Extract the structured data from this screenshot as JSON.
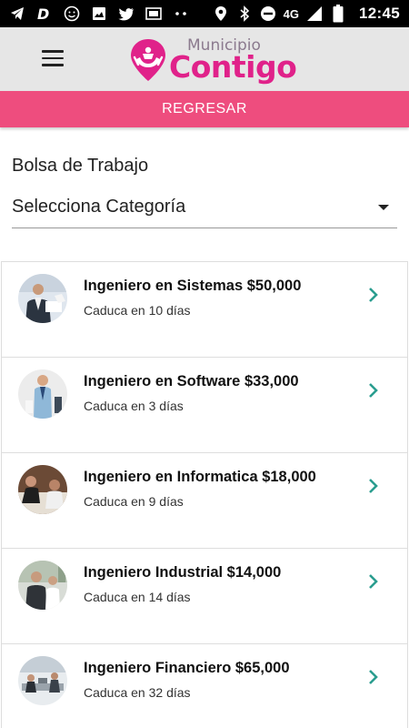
{
  "status_bar": {
    "time": "12:45",
    "network": "4G",
    "icons": [
      "telegram-icon",
      "d-app-icon",
      "emoji-icon",
      "image-icon",
      "twitter-icon",
      "screen-icon",
      "more-dots-icon",
      "location-icon",
      "bluetooth-icon",
      "do-not-disturb-icon",
      "signal-icon",
      "battery-icon"
    ]
  },
  "header": {
    "logo_top": "Municipio",
    "logo_main": "Contigo",
    "brand_color": "#e0228a"
  },
  "back_button": {
    "label": "REGRESAR",
    "color": "#ee4d7e"
  },
  "section": {
    "title": "Bolsa de Trabajo",
    "category_placeholder": "Selecciona Categoría"
  },
  "jobs": [
    {
      "title": "Ingeniero en Sistemas $50,000",
      "expiry": "Caduca en 10 días"
    },
    {
      "title": "Ingeniero en Software $33,000",
      "expiry": "Caduca en 3 días"
    },
    {
      "title": "Ingeniero en Informatica $18,000",
      "expiry": "Caduca en 9 días"
    },
    {
      "title": "Ingeniero Industrial $14,000",
      "expiry": "Caduca en 14 días"
    },
    {
      "title": "Ingeniero Financiero $65,000",
      "expiry": "Caduca en 32 días"
    }
  ],
  "accent_chevron_color": "#2a9d8f"
}
